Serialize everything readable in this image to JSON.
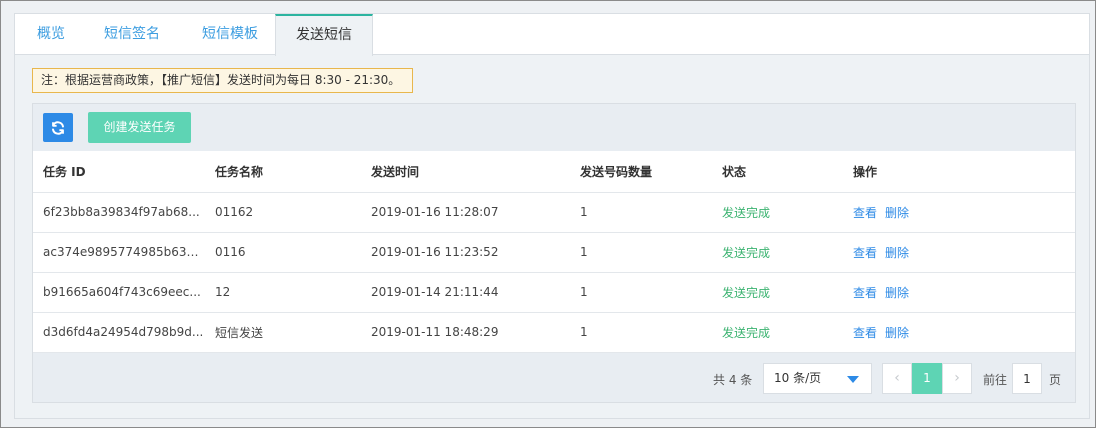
{
  "tabs": [
    {
      "label": "概览"
    },
    {
      "label": "短信签名"
    },
    {
      "label": "短信模板"
    },
    {
      "label": "发送短信"
    }
  ],
  "notice": "注：根据运营商政策，【推广短信】发送时间为每日 8:30 - 21:30。",
  "toolbar": {
    "refresh_icon": "refresh-icon",
    "create_label": "创建发送任务"
  },
  "table": {
    "headers": [
      "任务 ID",
      "任务名称",
      "发送时间",
      "发送号码数量",
      "状态",
      "操作"
    ],
    "rows": [
      {
        "id": "6f23bb8a39834f97ab68...",
        "name": "01162",
        "time": "2019-01-16 11:28:07",
        "count": "1",
        "status": "发送完成",
        "view": "查看",
        "delete": "删除"
      },
      {
        "id": "ac374e9895774985b63e...",
        "name": "0116",
        "time": "2019-01-16 11:23:52",
        "count": "1",
        "status": "发送完成",
        "view": "查看",
        "delete": "删除"
      },
      {
        "id": "b91665a604f743c69eec...",
        "name": "12",
        "time": "2019-01-14 21:11:44",
        "count": "1",
        "status": "发送完成",
        "view": "查看",
        "delete": "删除"
      },
      {
        "id": "d3d6fd4a24954d798b9d...",
        "name": "短信发送",
        "time": "2019-01-11 18:48:29",
        "count": "1",
        "status": "发送完成",
        "view": "查看",
        "delete": "删除"
      }
    ]
  },
  "pagination": {
    "total_text": "共 4 条",
    "page_size": "10 条/页",
    "current_page": "1",
    "goto_label": "前往",
    "goto_value": "1",
    "page_suffix": "页",
    "prev_glyph": "‹",
    "next_glyph": "›"
  },
  "colors": {
    "accent": "#5ed4b4",
    "link": "#2d8ae6",
    "success": "#3cb371",
    "notice_border": "#e8b74d"
  }
}
